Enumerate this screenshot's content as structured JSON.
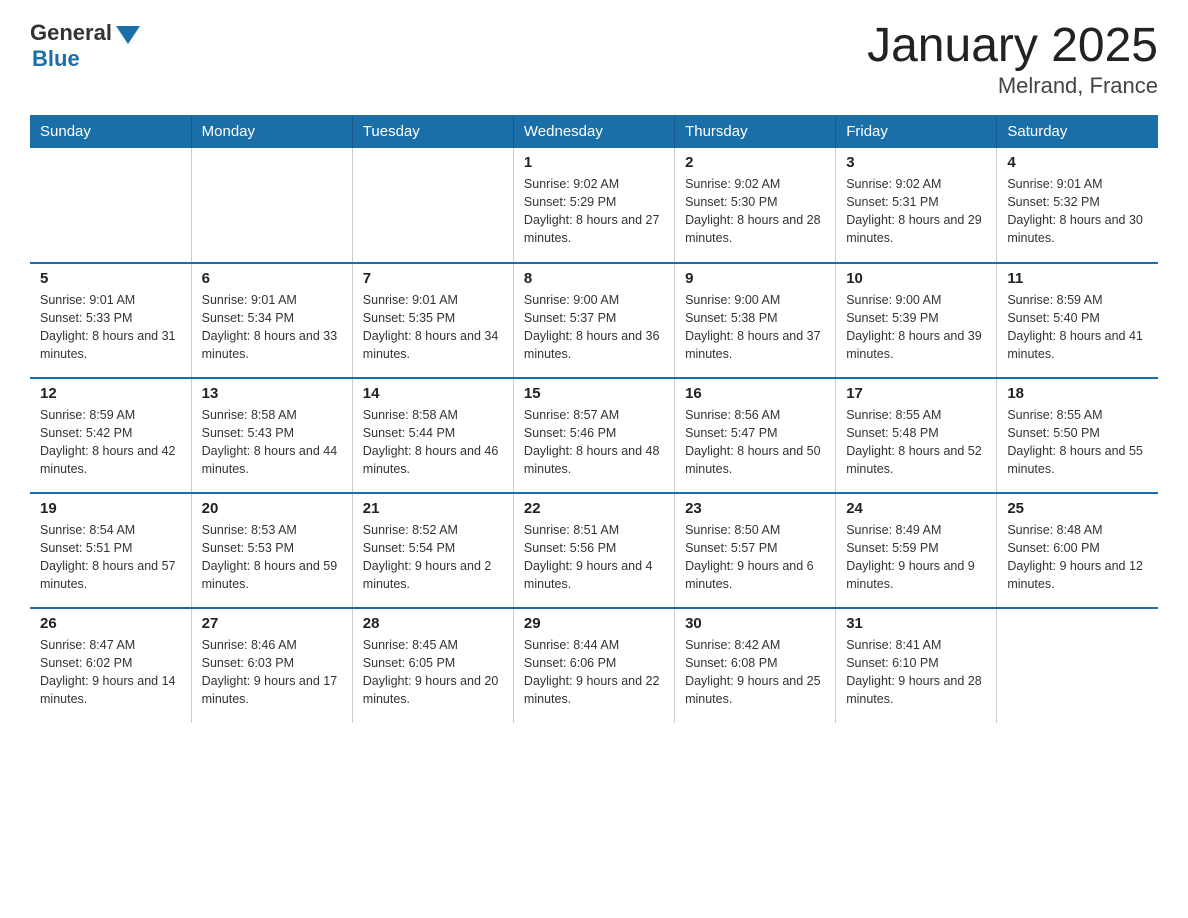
{
  "header": {
    "logo_general": "General",
    "logo_blue": "Blue",
    "title": "January 2025",
    "subtitle": "Melrand, France"
  },
  "days_of_week": [
    "Sunday",
    "Monday",
    "Tuesday",
    "Wednesday",
    "Thursday",
    "Friday",
    "Saturday"
  ],
  "weeks": [
    [
      {
        "num": "",
        "info": ""
      },
      {
        "num": "",
        "info": ""
      },
      {
        "num": "",
        "info": ""
      },
      {
        "num": "1",
        "info": "Sunrise: 9:02 AM\nSunset: 5:29 PM\nDaylight: 8 hours\nand 27 minutes."
      },
      {
        "num": "2",
        "info": "Sunrise: 9:02 AM\nSunset: 5:30 PM\nDaylight: 8 hours\nand 28 minutes."
      },
      {
        "num": "3",
        "info": "Sunrise: 9:02 AM\nSunset: 5:31 PM\nDaylight: 8 hours\nand 29 minutes."
      },
      {
        "num": "4",
        "info": "Sunrise: 9:01 AM\nSunset: 5:32 PM\nDaylight: 8 hours\nand 30 minutes."
      }
    ],
    [
      {
        "num": "5",
        "info": "Sunrise: 9:01 AM\nSunset: 5:33 PM\nDaylight: 8 hours\nand 31 minutes."
      },
      {
        "num": "6",
        "info": "Sunrise: 9:01 AM\nSunset: 5:34 PM\nDaylight: 8 hours\nand 33 minutes."
      },
      {
        "num": "7",
        "info": "Sunrise: 9:01 AM\nSunset: 5:35 PM\nDaylight: 8 hours\nand 34 minutes."
      },
      {
        "num": "8",
        "info": "Sunrise: 9:00 AM\nSunset: 5:37 PM\nDaylight: 8 hours\nand 36 minutes."
      },
      {
        "num": "9",
        "info": "Sunrise: 9:00 AM\nSunset: 5:38 PM\nDaylight: 8 hours\nand 37 minutes."
      },
      {
        "num": "10",
        "info": "Sunrise: 9:00 AM\nSunset: 5:39 PM\nDaylight: 8 hours\nand 39 minutes."
      },
      {
        "num": "11",
        "info": "Sunrise: 8:59 AM\nSunset: 5:40 PM\nDaylight: 8 hours\nand 41 minutes."
      }
    ],
    [
      {
        "num": "12",
        "info": "Sunrise: 8:59 AM\nSunset: 5:42 PM\nDaylight: 8 hours\nand 42 minutes."
      },
      {
        "num": "13",
        "info": "Sunrise: 8:58 AM\nSunset: 5:43 PM\nDaylight: 8 hours\nand 44 minutes."
      },
      {
        "num": "14",
        "info": "Sunrise: 8:58 AM\nSunset: 5:44 PM\nDaylight: 8 hours\nand 46 minutes."
      },
      {
        "num": "15",
        "info": "Sunrise: 8:57 AM\nSunset: 5:46 PM\nDaylight: 8 hours\nand 48 minutes."
      },
      {
        "num": "16",
        "info": "Sunrise: 8:56 AM\nSunset: 5:47 PM\nDaylight: 8 hours\nand 50 minutes."
      },
      {
        "num": "17",
        "info": "Sunrise: 8:55 AM\nSunset: 5:48 PM\nDaylight: 8 hours\nand 52 minutes."
      },
      {
        "num": "18",
        "info": "Sunrise: 8:55 AM\nSunset: 5:50 PM\nDaylight: 8 hours\nand 55 minutes."
      }
    ],
    [
      {
        "num": "19",
        "info": "Sunrise: 8:54 AM\nSunset: 5:51 PM\nDaylight: 8 hours\nand 57 minutes."
      },
      {
        "num": "20",
        "info": "Sunrise: 8:53 AM\nSunset: 5:53 PM\nDaylight: 8 hours\nand 59 minutes."
      },
      {
        "num": "21",
        "info": "Sunrise: 8:52 AM\nSunset: 5:54 PM\nDaylight: 9 hours\nand 2 minutes."
      },
      {
        "num": "22",
        "info": "Sunrise: 8:51 AM\nSunset: 5:56 PM\nDaylight: 9 hours\nand 4 minutes."
      },
      {
        "num": "23",
        "info": "Sunrise: 8:50 AM\nSunset: 5:57 PM\nDaylight: 9 hours\nand 6 minutes."
      },
      {
        "num": "24",
        "info": "Sunrise: 8:49 AM\nSunset: 5:59 PM\nDaylight: 9 hours\nand 9 minutes."
      },
      {
        "num": "25",
        "info": "Sunrise: 8:48 AM\nSunset: 6:00 PM\nDaylight: 9 hours\nand 12 minutes."
      }
    ],
    [
      {
        "num": "26",
        "info": "Sunrise: 8:47 AM\nSunset: 6:02 PM\nDaylight: 9 hours\nand 14 minutes."
      },
      {
        "num": "27",
        "info": "Sunrise: 8:46 AM\nSunset: 6:03 PM\nDaylight: 9 hours\nand 17 minutes."
      },
      {
        "num": "28",
        "info": "Sunrise: 8:45 AM\nSunset: 6:05 PM\nDaylight: 9 hours\nand 20 minutes."
      },
      {
        "num": "29",
        "info": "Sunrise: 8:44 AM\nSunset: 6:06 PM\nDaylight: 9 hours\nand 22 minutes."
      },
      {
        "num": "30",
        "info": "Sunrise: 8:42 AM\nSunset: 6:08 PM\nDaylight: 9 hours\nand 25 minutes."
      },
      {
        "num": "31",
        "info": "Sunrise: 8:41 AM\nSunset: 6:10 PM\nDaylight: 9 hours\nand 28 minutes."
      },
      {
        "num": "",
        "info": ""
      }
    ]
  ]
}
